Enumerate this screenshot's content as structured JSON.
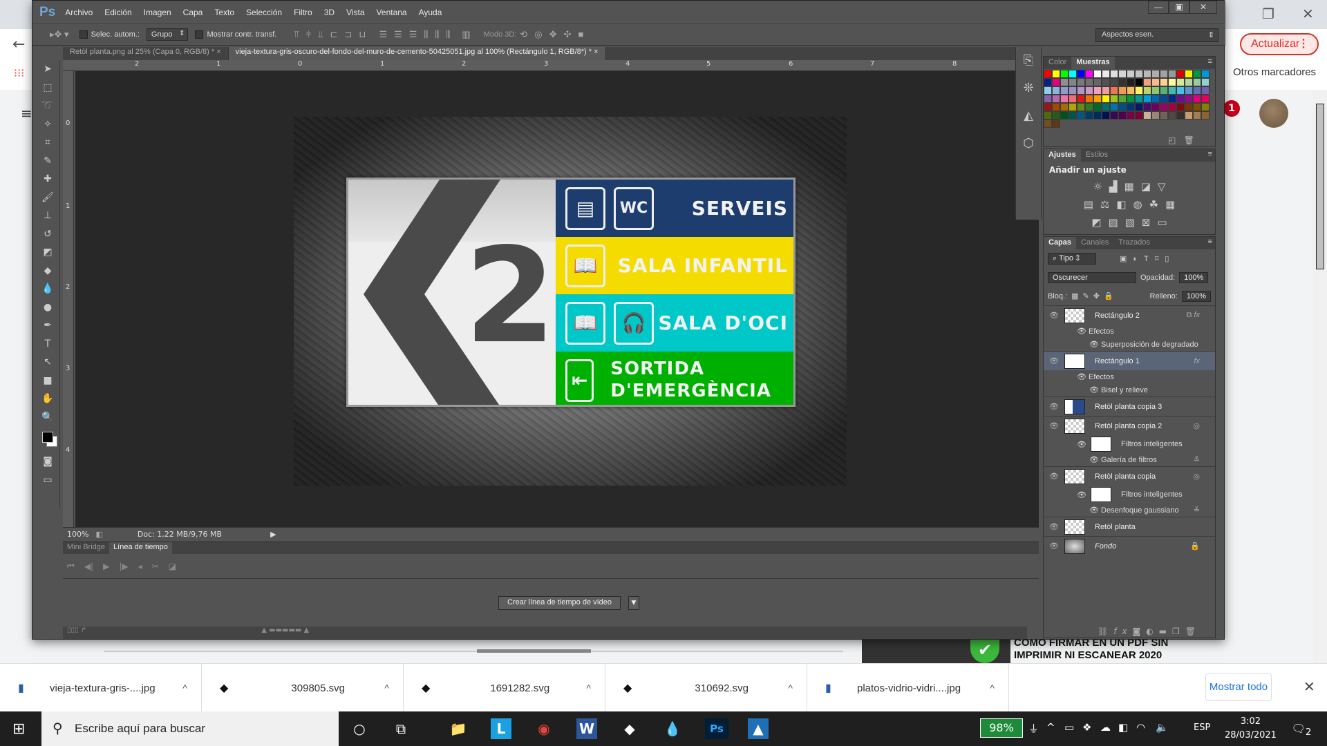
{
  "browser": {
    "update_label": "Actualizar",
    "bookmarks_label": "Otros marcadores",
    "notification_count": "1",
    "article_title_line1": "CÓMO FIRMAR EN UN PDF SIN",
    "article_title_line2": "IMPRIMIR NI ESCANEAR 2020"
  },
  "photoshop": {
    "logo": "Ps",
    "menu": [
      "Archivo",
      "Edición",
      "Imagen",
      "Capa",
      "Texto",
      "Selección",
      "Filtro",
      "3D",
      "Vista",
      "Ventana",
      "Ayuda"
    ],
    "options": {
      "auto_select_label": "Selec. autom.:",
      "auto_select_value": "Grupo",
      "show_transform_label": "Mostrar contr. transf.",
      "mode3d_label": "Modo 3D:",
      "workspace": "Aspectos esen."
    },
    "doc_tabs": [
      {
        "label": "Retòl planta.png al 25% (Capa 0, RGB/8) *",
        "active": false
      },
      {
        "label": "vieja-textura-gris-oscuro-del-fondo-del-muro-de-cemento-50425051.jpg al 100% (Rectángulo 1, RGB/8*) *",
        "active": true
      }
    ],
    "ruler_h": [
      "2",
      "1",
      "0",
      "1",
      "2",
      "3",
      "4",
      "5",
      "6",
      "7",
      "8"
    ],
    "ruler_v": [
      "0",
      "1",
      "2",
      "3",
      "4"
    ],
    "sign": {
      "number": "2",
      "bands": [
        {
          "text": "SERVEIS",
          "color": "#1d3d6e",
          "icons": [
            "wc-tap-icon",
            "WC"
          ]
        },
        {
          "text": "SALA INFANTIL",
          "color": "#f4dc00",
          "icons": [
            "book-icon"
          ]
        },
        {
          "text": "SALA D'OCI",
          "color": "#00c8c8",
          "icons": [
            "book-icon",
            "headphones-icon"
          ]
        },
        {
          "text": "SORTIDA D'EMERGÈNCIA",
          "color": "#00b000",
          "icons": [
            "exit-icon"
          ]
        }
      ]
    },
    "status": {
      "zoom": "100%",
      "doc": "Doc: 1,22 MB/9,76 MB"
    },
    "timeline": {
      "tabs": [
        "Mini Bridge",
        "Línea de tiempo"
      ],
      "active_tab": 1,
      "create_label": "Crear línea de tiempo de vídeo"
    },
    "color_panel": {
      "tabs": [
        "Color",
        "Muestras"
      ],
      "active_tab": 1,
      "swatches": [
        "#ff0000",
        "#ffff00",
        "#00ff00",
        "#00ffff",
        "#0000ff",
        "#ff00ff",
        "#ffffff",
        "#ebebeb",
        "#e0e0e0",
        "#d6d6d6",
        "#cccccc",
        "#c2c2c2",
        "#b8b8b8",
        "#adadad",
        "#a3a3a3",
        "#999999",
        "#e00000",
        "#fff000",
        "#009a44",
        "#0096dc",
        "#0a1e8c",
        "#e6007e",
        "#8f8f8f",
        "#858585",
        "#7a7a7a",
        "#707070",
        "#666666",
        "#525252",
        "#474747",
        "#333333",
        "#1f1f1f",
        "#000000",
        "#f4a07c",
        "#f9b98a",
        "#fdd28d",
        "#fff799",
        "#d6e69d",
        "#b2d79c",
        "#98cc9f",
        "#8fd3cf",
        "#8ccff4",
        "#8fb3dd",
        "#9199cd",
        "#9893c7",
        "#b294c7",
        "#ce99c8",
        "#f09ec4",
        "#f09da0",
        "#ee7752",
        "#f39a58",
        "#fbb85b",
        "#fff263",
        "#b9d56a",
        "#8dc672",
        "#56b27a",
        "#46b8b1",
        "#48c0ea",
        "#5a98d2",
        "#5d72b6",
        "#6e60ab",
        "#8c61ab",
        "#b26bad",
        "#ed74a9",
        "#ef6e75",
        "#e21616",
        "#ee7300",
        "#f8a000",
        "#fff100",
        "#9dc41b",
        "#4dab2e",
        "#00973d",
        "#009a93",
        "#00a0e6",
        "#0069b4",
        "#004a99",
        "#00288c",
        "#6b0e8d",
        "#960a8e",
        "#e3007e",
        "#e5005b",
        "#9c1416",
        "#a34800",
        "#a86b00",
        "#b5a500",
        "#678a14",
        "#2f7c21",
        "#006c2a",
        "#006f6a",
        "#0073a8",
        "#004f8a",
        "#00367a",
        "#001b6a",
        "#4c0a6e",
        "#6b0069",
        "#a10060",
        "#a50042",
        "#7c0c0e",
        "#7a3600",
        "#7e5100",
        "#878000",
        "#4d6b0d",
        "#225e19",
        "#00521d",
        "#00534f",
        "#005887",
        "#003b6a",
        "#00295e",
        "#001050",
        "#370654",
        "#4f004f",
        "#7a0048",
        "#7d0030",
        "#c7b299",
        "#998675",
        "#736357",
        "#534741",
        "#362f2d",
        "#c69c6d",
        "#a67c52",
        "#8c6239",
        "#754c24",
        "#603813"
      ]
    },
    "adjust_panel": {
      "tabs": [
        "Ajustes",
        "Estilos"
      ],
      "active_tab": 0,
      "title": "Añadir un ajuste"
    },
    "layers_panel": {
      "tabs": [
        "Capas",
        "Canales",
        "Trazados"
      ],
      "active_tab": 0,
      "filter": "Tipo",
      "blend_mode": "Oscurecer",
      "opacity_label": "Opacidad:",
      "opacity": "100%",
      "lock_label": "Bloq.:",
      "fill_label": "Relleno:",
      "fill": "100%",
      "layers": [
        {
          "name": "Rectángulo 2",
          "selected": false,
          "fx": true,
          "effects_label": "Efectos",
          "effects": [
            "Superposición de degradado"
          ]
        },
        {
          "name": "Rectángulo 1",
          "selected": true,
          "fx": true,
          "effects_label": "Efectos",
          "effects": [
            "Bisel y relieve"
          ]
        },
        {
          "name": "Retòl planta copia 3",
          "selected": false
        },
        {
          "name": "Retòl planta copia 2",
          "selected": false,
          "smart_label": "Filtros inteligentes",
          "filters": [
            "Galería de filtros"
          ]
        },
        {
          "name": "Retòl planta copia",
          "selected": false,
          "smart_label": "Filtros inteligentes",
          "filters": [
            "Desenfoque gaussiano"
          ]
        },
        {
          "name": "Retòl planta",
          "selected": false
        },
        {
          "name": "Fondo",
          "selected": false,
          "locked": true
        }
      ]
    }
  },
  "downloads": {
    "items": [
      "vieja-textura-gris-....jpg",
      "309805.svg",
      "1691282.svg",
      "310692.svg",
      "platos-vidrio-vidri....jpg"
    ],
    "show_all": "Mostrar todo"
  },
  "taskbar": {
    "search_placeholder": "Escribe aquí para buscar",
    "battery": "98%",
    "lang": "ESP",
    "time": "3:02",
    "date": "28/03/2021",
    "notifications": "2"
  }
}
